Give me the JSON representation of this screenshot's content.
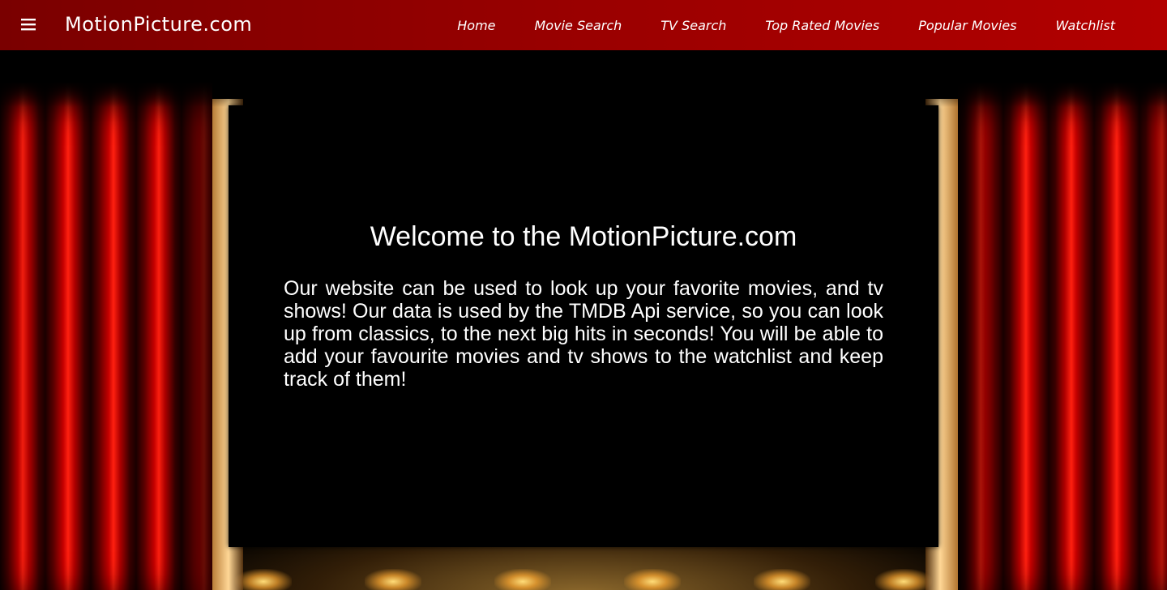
{
  "navbar": {
    "brand": "MotionPicture.com",
    "menu_icon": "hamburger-menu-icon",
    "links": [
      {
        "label": "Home"
      },
      {
        "label": "Movie Search"
      },
      {
        "label": "TV Search"
      },
      {
        "label": "Top Rated Movies"
      },
      {
        "label": "Popular Movies"
      },
      {
        "label": "Watchlist"
      }
    ],
    "colors": {
      "gradient_start": "#7a0000",
      "gradient_end": "#b20000",
      "text": "#ffffff"
    }
  },
  "main": {
    "title": "Welcome to the MotionPicture.com",
    "description": "Our website can be used to look up your favorite movies, and tv shows! Our data is used by the TMDB Api service, so you can look up from classics, to the next big hits in seconds! You will be able to add your favourite movies and tv shows to the watchlist and keep track of them!",
    "background": "theater-stage-curtains",
    "colors": {
      "curtain": "#c40000",
      "stage_light": "#ffd796",
      "screen": "#000000"
    }
  }
}
